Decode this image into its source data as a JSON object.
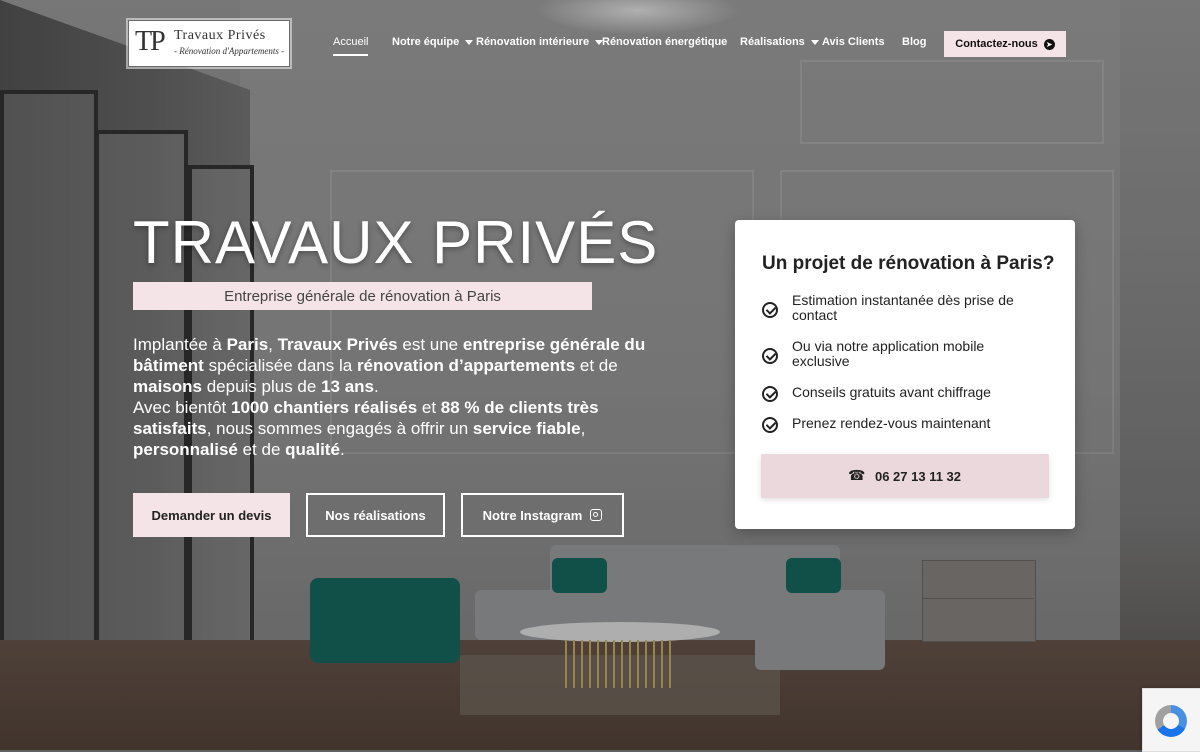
{
  "brand": {
    "mark": "TP",
    "name": "Travaux Privés",
    "tagline": "- Rénovation d'Appartements -"
  },
  "nav": {
    "items": [
      {
        "label": "Accueil",
        "active": true,
        "has_dropdown": false
      },
      {
        "label": "Notre équipe",
        "active": false,
        "has_dropdown": true
      },
      {
        "label": "Rénovation intérieure",
        "active": false,
        "has_dropdown": true
      },
      {
        "label": "Rénovation énergétique",
        "active": false,
        "has_dropdown": false
      },
      {
        "label": "Réalisations",
        "active": false,
        "has_dropdown": true
      },
      {
        "label": "Avis Clients",
        "active": false,
        "has_dropdown": false
      },
      {
        "label": "Blog",
        "active": false,
        "has_dropdown": false
      }
    ],
    "cta": "Contactez-nous"
  },
  "hero": {
    "title": "TRAVAUX PRIVÉS",
    "subtitle": "Entreprise générale de rénovation à Paris",
    "paragraph": [
      {
        "t": "Implantée à ",
        "b": false
      },
      {
        "t": "Paris",
        "b": true
      },
      {
        "t": ", ",
        "b": false
      },
      {
        "t": "Travaux Privés",
        "b": true
      },
      {
        "t": " est une ",
        "b": false
      },
      {
        "t": "entreprise générale du bâtiment",
        "b": true
      },
      {
        "t": " spécialisée dans la ",
        "b": false
      },
      {
        "t": "rénovation d’appartements",
        "b": true
      },
      {
        "t": " et de ",
        "b": false
      },
      {
        "t": "maisons",
        "b": true
      },
      {
        "t": " depuis plus de ",
        "b": false
      },
      {
        "t": "13 ans",
        "b": true
      },
      {
        "t": ".",
        "b": false
      },
      {
        "t": "BR",
        "b": false
      },
      {
        "t": "Avec bientôt ",
        "b": false
      },
      {
        "t": "1000 chantiers réalisés",
        "b": true
      },
      {
        "t": " et ",
        "b": false
      },
      {
        "t": "88 % de clients très satisfaits",
        "b": true
      },
      {
        "t": ", nous sommes engagés à offrir un ",
        "b": false
      },
      {
        "t": "service fiable",
        "b": true
      },
      {
        "t": ", ",
        "b": false
      },
      {
        "t": "personnalisé",
        "b": true
      },
      {
        "t": " et de ",
        "b": false
      },
      {
        "t": "qualité",
        "b": true
      },
      {
        "t": ".",
        "b": false
      }
    ],
    "buttons": {
      "quote": "Demander un devis",
      "projects": "Nos réalisations",
      "instagram": "Notre Instagram"
    }
  },
  "card": {
    "title": "Un projet de rénovation à Paris?",
    "items": [
      "Estimation instantanée dès prise de contact",
      "Ou via notre application mobile exclusive",
      "Conseils gratuits avant chiffrage",
      "Prenez rendez-vous maintenant"
    ],
    "phone": "06 27 13 11 32"
  },
  "colors": {
    "accent_pink": "#f4e4e8",
    "text_dark": "#222222",
    "teal_furniture": "#0e5c52"
  },
  "icons": [
    "chevron-down-icon",
    "arrow-right-circle-icon",
    "instagram-icon",
    "check-circle-icon",
    "phone-icon",
    "recaptcha-icon"
  ]
}
